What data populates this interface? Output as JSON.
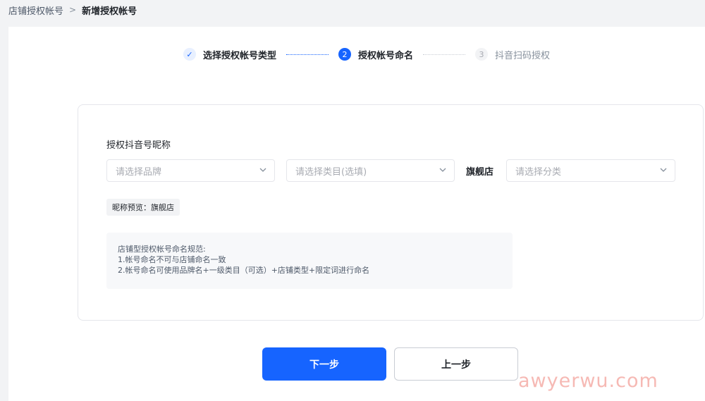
{
  "breadcrumb": {
    "parent": "店铺授权帐号",
    "separator": ">",
    "current": "新增授权帐号"
  },
  "steps": [
    {
      "number": "✓",
      "label": "选择授权帐号类型",
      "state": "done"
    },
    {
      "number": "2",
      "label": "授权帐号命名",
      "state": "active"
    },
    {
      "number": "3",
      "label": "抖音扫码授权",
      "state": "pending"
    }
  ],
  "form": {
    "label": "授权抖音号昵称",
    "brand_placeholder": "请选择品牌",
    "category_placeholder": "请选择类目(选填)",
    "suffix": "旗舰店",
    "type_placeholder": "请选择分类",
    "preview_label": "昵称预览：",
    "preview_value": "旗舰店"
  },
  "rules": {
    "title": "店铺型授权帐号命名规范:",
    "items": [
      "1.帐号命名不可与店铺命名一致",
      "2.帐号命名可使用品牌名+一级类目（可选）+店铺类型+限定词进行命名"
    ]
  },
  "buttons": {
    "next": "下一步",
    "prev": "上一步"
  },
  "watermark": "awyerwu.com",
  "colors": {
    "primary": "#1664ff",
    "background": "#f2f3f5",
    "watermark": "#f6b9b4"
  }
}
